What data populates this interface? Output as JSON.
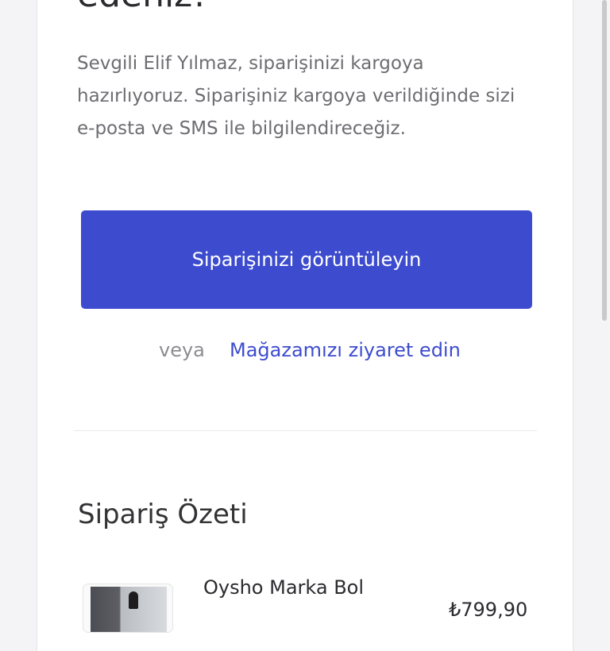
{
  "confirmation": {
    "heading_tail": "edeniz!",
    "message": "Sevgili Elif Yılmaz, siparişinizi kargoya hazırlıyoruz. Siparişiniz kargoya verildiğinde sizi e-posta ve SMS ile bilgilendireceğiz.",
    "view_order_button": "Siparişinizi görüntüleyin",
    "or_text": "veya",
    "store_link": "Mağazamızı ziyaret edin"
  },
  "summary": {
    "title": "Sipariş Özeti",
    "items": [
      {
        "name": "Oysho Marka Bol",
        "variant": "",
        "price": "₺799,90"
      }
    ]
  },
  "colors": {
    "accent": "#3d4ccf",
    "background": "#f4f4f6",
    "card": "#ffffff"
  }
}
